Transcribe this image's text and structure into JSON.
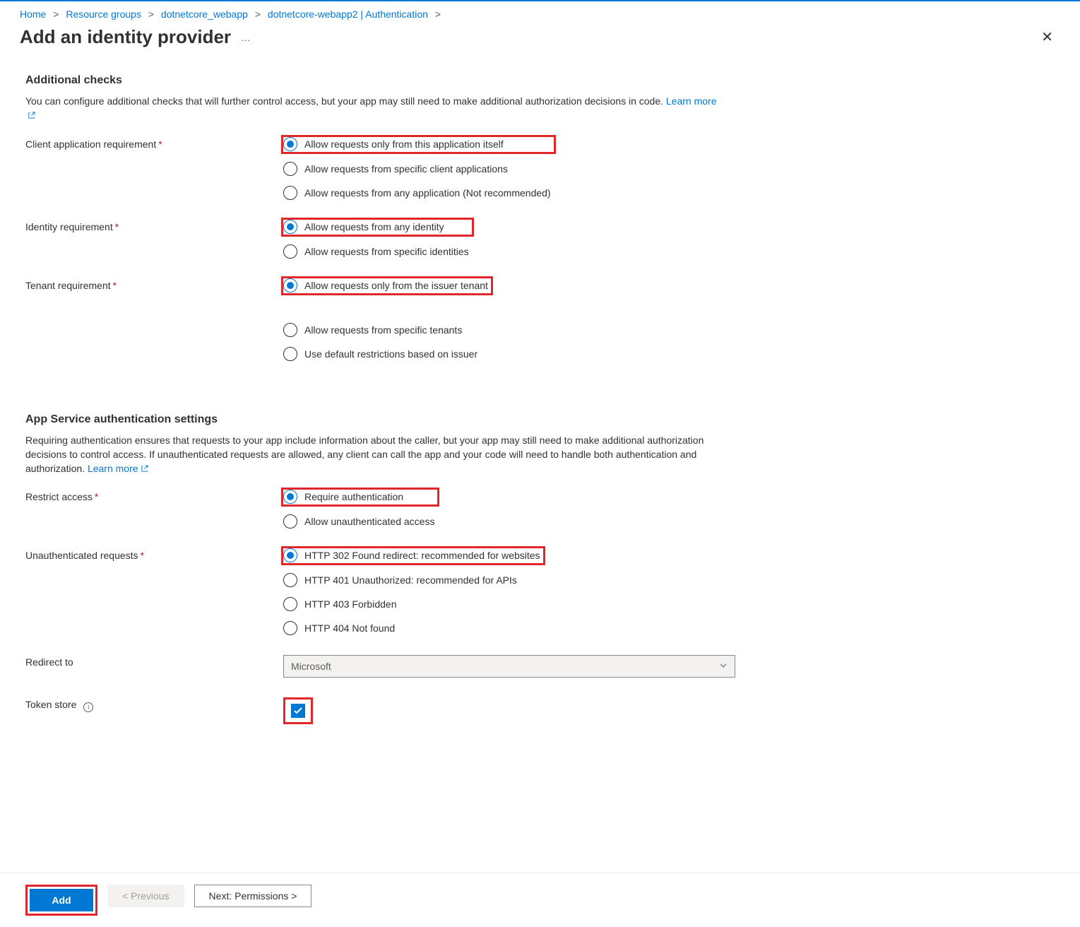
{
  "breadcrumb": {
    "items": [
      "Home",
      "Resource groups",
      "dotnetcore_webapp",
      "dotnetcore-webapp2 | Authentication"
    ]
  },
  "header": {
    "title": "Add an identity provider"
  },
  "section1": {
    "title": "Additional checks",
    "desc": "You can configure additional checks that will further control access, but your app may still need to make additional authorization decisions in code. ",
    "learn_more": "Learn more"
  },
  "client_app_req": {
    "label": "Client application requirement",
    "opt0": "Allow requests only from this application itself",
    "opt1": "Allow requests from specific client applications",
    "opt2": "Allow requests from any application (Not recommended)"
  },
  "identity_req": {
    "label": "Identity requirement",
    "opt0": "Allow requests from any identity",
    "opt1": "Allow requests from specific identities"
  },
  "tenant_req": {
    "label": "Tenant requirement",
    "opt0": "Allow requests only from the issuer tenant",
    "opt1": "Allow requests from specific tenants",
    "opt2": "Use default restrictions based on issuer"
  },
  "section2": {
    "title": "App Service authentication settings",
    "desc": "Requiring authentication ensures that requests to your app include information about the caller, but your app may still need to make additional authorization decisions to control access. If unauthenticated requests are allowed, any client can call the app and your code will need to handle both authentication and authorization. ",
    "learn_more": "Learn more"
  },
  "restrict": {
    "label": "Restrict access",
    "opt0": "Require authentication",
    "opt1": "Allow unauthenticated access"
  },
  "unauth": {
    "label": "Unauthenticated requests",
    "opt0": "HTTP 302 Found redirect: recommended for websites",
    "opt1": "HTTP 401 Unauthorized: recommended for APIs",
    "opt2": "HTTP 403 Forbidden",
    "opt3": "HTTP 404 Not found"
  },
  "redirect": {
    "label": "Redirect to",
    "value": "Microsoft"
  },
  "token_store": {
    "label": "Token store"
  },
  "footer": {
    "add": "Add",
    "prev": "< Previous",
    "next": "Next: Permissions >"
  }
}
